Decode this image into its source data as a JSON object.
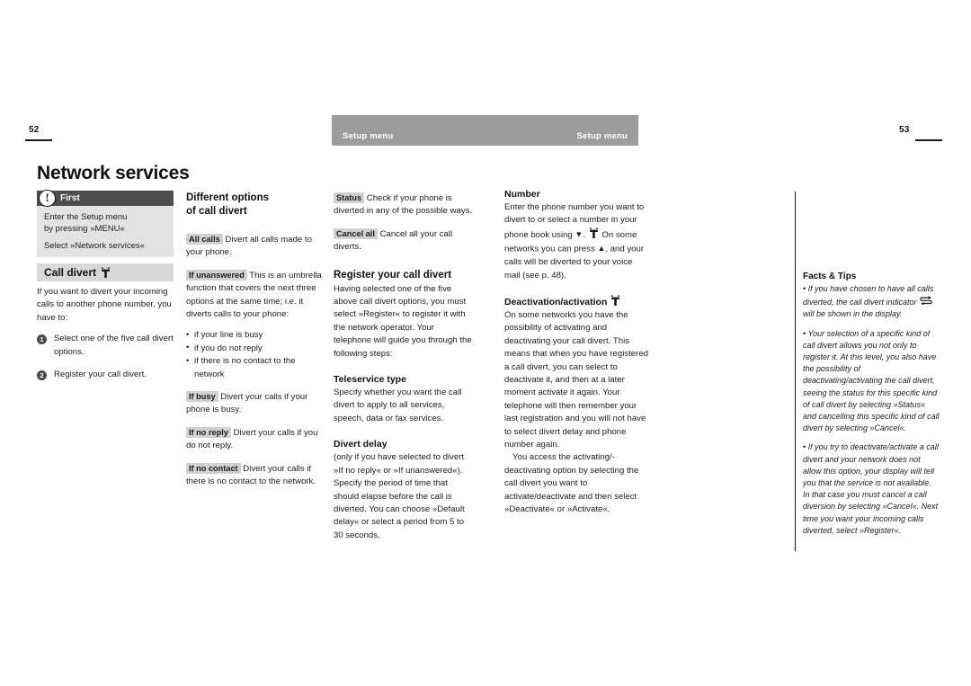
{
  "document": {
    "left_page_number": "52",
    "right_page_number": "53",
    "running_head_left": "Setup menu",
    "running_head_right": "Setup menu",
    "chapter_title": "Network services"
  },
  "colors": {
    "running_head_bar": "#9c9c9c",
    "tipbox_background": "#e3e3e3",
    "tipbox_header": "#4d4d4d",
    "section_bar": "#d8d8d8",
    "chip_background": "#d1d1d1",
    "text": "#1d1d1d"
  },
  "first_box": {
    "header_label": "First",
    "icon": "exclamation-icon",
    "line1": "Enter the Setup menu",
    "line2": "by pressing »MENU«",
    "line3": "Select »Network services«"
  },
  "call_divert_section": {
    "bar_label": "Call divert",
    "bar_icon": "nav-key-icon",
    "intro": "If you want to divert your incoming calls to another phone number, you have to:",
    "steps": [
      {
        "number": "1",
        "text": "Select one of the five call divert options."
      },
      {
        "number": "2",
        "text": "Register your call divert."
      }
    ]
  },
  "different_options": {
    "heading_line1": "Different options",
    "heading_line2": "of call divert",
    "items": [
      {
        "chip": "All calls",
        "text": "Divert all calls made to your phone."
      },
      {
        "chip": "If unanswered",
        "text": "This is an umbrella function that covers the next three options at the same time; i.e. it diverts calls to your phone:",
        "bullets": [
          "if your line is busy",
          "if you do not reply",
          "if there is no contact to the network"
        ]
      },
      {
        "chip": "If busy",
        "text": "Divert your calls if your phone is busy."
      },
      {
        "chip": "If no reply",
        "text": "Divert your calls if you do not reply."
      },
      {
        "chip": "If no contact",
        "text": "Divert your calls if there is no contact to the network."
      }
    ]
  },
  "column3": {
    "items": [
      {
        "chip": "Status",
        "text": "Check if your phone is diverted in any of the possible ways."
      },
      {
        "chip": "Cancel all",
        "text": "Cancel all your call diverts."
      }
    ],
    "register": {
      "heading": "Register your call divert",
      "body": "Having selected one of the five above call divert options, you must select »Register« to register it with the network operator. Your telephone will guide you through the following steps:"
    },
    "teleservice": {
      "heading": "Teleservice type",
      "body": "Specify whether you want the call divert to apply to all services, speech, data or fax services."
    },
    "divert_delay": {
      "heading": "Divert delay",
      "body": "(only if you have selected to divert »If no reply« or »If unanswered«). Specify the period of time that should elapse before the call is diverted. You can choose »Default delay« or select a period from 5 to 30 seconds."
    }
  },
  "column4": {
    "number": {
      "heading": "Number",
      "part1": "Enter the phone number you want to divert to or select a number in your phone book using",
      "glyph_down": "▼",
      "part2": ".",
      "icon": "nav-key-icon",
      "part3": "On some networks you can press",
      "glyph_up": "▲",
      "part4": ", and your calls will be diverted to your voice mail (see p. 48)."
    },
    "deactivation": {
      "heading": "Deactivation/activation",
      "heading_icon": "nav-key-icon",
      "para1": "On some networks you have the possibility of activating and deactivating your call divert. This means that when you have registered a call divert, you can select to deactivate it, and then at a later moment activate it again. Your telephone will then remember your last registration and you will not have to select divert delay and phone number again.",
      "para2": "You access the activating/-deactivating option by selecting the call divert you want to activate/deactivate and then select »Deactivate« or »Activate«."
    }
  },
  "facts_and_tips": {
    "heading": "Facts & Tips",
    "bullet1_part1": "If you have chosen to have all calls diverted, the call divert indicator",
    "bullet1_icon": "call-divert-indicator-icon",
    "bullet1_part2": "will be shown in the display.",
    "bullet2": "Your selection of a specific kind of call divert allows you not only to register it. At this level, you also have the possibility of deactivating/activating the call divert, seeing the status for this specific kind of call divert by selecting »Status« and cancelling this specific kind of call divert by selecting »Cancel«.",
    "bullet3": "If you try to deactivate/activate a call divert and your network does not allow this option, your display will tell you that the service is not available. In that case you must cancel a call diversion by selecting »Cancel«. Next time you want your incoming calls diverted, select »Register«."
  }
}
